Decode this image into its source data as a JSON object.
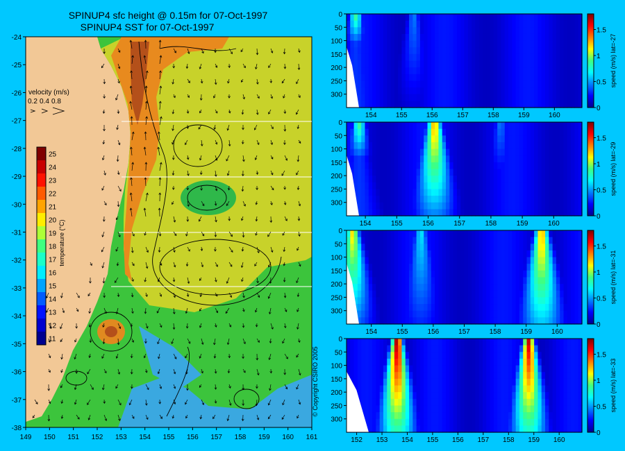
{
  "page": {
    "title_line1": "SPINUP4 sfc height @ 0.15m for 07-Oct-1997",
    "title_line2": "SPINUP4 SST for 07-Oct-1997",
    "copyright": "© Copyright CSIRO 2005"
  },
  "map": {
    "velocity_label": "velocity (m/s)",
    "velocity_scale": [
      "0.2",
      "0.4",
      "0.8"
    ],
    "colorbar_label": "temperature (°C)",
    "colorbar_ticks": [
      "25",
      "24",
      "23",
      "22",
      "21",
      "20",
      "19",
      "18",
      "17",
      "16",
      "15",
      "14",
      "13",
      "12",
      "11"
    ],
    "lon_ticks": [
      "149",
      "150",
      "151",
      "152",
      "153",
      "154",
      "155",
      "156",
      "157",
      "158",
      "159",
      "160",
      "161"
    ],
    "lat_ticks": [
      "-24",
      "-25",
      "-26",
      "-27",
      "-28",
      "-29",
      "-30",
      "-31",
      "-32",
      "-33",
      "-34",
      "-35",
      "-36",
      "-37",
      "-38"
    ],
    "section_lats": [
      "-27",
      "-29",
      "-31",
      "-33"
    ]
  },
  "chart_data": [
    {
      "type": "heatmap",
      "title": "",
      "ylabel": "speed (m/s) lat=-27",
      "xlim": [
        153.2,
        160.9
      ],
      "ylim": [
        350,
        0
      ],
      "x_ticks": [
        "154",
        "155",
        "156",
        "157",
        "158",
        "159",
        "160"
      ],
      "y_ticks": [
        "0",
        "50",
        "100",
        "150",
        "200",
        "250",
        "300"
      ],
      "colorbar_ticks": [
        "1.5",
        "1",
        "0.5",
        "0"
      ],
      "jets": [
        {
          "lon": 153.5,
          "peak_speed": 0.9,
          "depth": 100
        },
        {
          "lon": 155.4,
          "peak_speed": 0.45,
          "depth": 300
        }
      ]
    },
    {
      "type": "heatmap",
      "title": "",
      "ylabel": "speed (m/s) lat=-29",
      "xlim": [
        153.4,
        160.9
      ],
      "ylim": [
        350,
        0
      ],
      "x_ticks": [
        "154",
        "155",
        "156",
        "157",
        "158",
        "159",
        "160"
      ],
      "y_ticks": [
        "0",
        "50",
        "100",
        "150",
        "200",
        "250",
        "300"
      ],
      "colorbar_ticks": [
        "1.5",
        "1",
        "0.5",
        "0"
      ],
      "jets": [
        {
          "lon": 153.8,
          "peak_speed": 0.9,
          "depth": 120
        },
        {
          "lon": 156.2,
          "peak_speed": 1.3,
          "depth": 300
        },
        {
          "lon": 158.3,
          "peak_speed": 0.45,
          "depth": 200
        }
      ]
    },
    {
      "type": "heatmap",
      "title": "",
      "ylabel": "speed (m/s) lat=-31",
      "xlim": [
        153.2,
        160.8
      ],
      "ylim": [
        350,
        0
      ],
      "x_ticks": [
        "154",
        "155",
        "156",
        "157",
        "158",
        "159",
        "160"
      ],
      "y_ticks": [
        "0",
        "50",
        "100",
        "150",
        "200",
        "250",
        "300"
      ],
      "colorbar_ticks": [
        "1.5",
        "1",
        "0.5",
        "0"
      ],
      "jets": [
        {
          "lon": 153.4,
          "peak_speed": 1.2,
          "depth": 300
        },
        {
          "lon": 155.6,
          "peak_speed": 0.65,
          "depth": 350
        },
        {
          "lon": 159.5,
          "peak_speed": 1.3,
          "depth": 350
        }
      ]
    },
    {
      "type": "heatmap",
      "title": "",
      "ylabel": "speed (m/s) lat=-33",
      "xlim": [
        151.6,
        160.9
      ],
      "ylim": [
        350,
        0
      ],
      "x_ticks": [
        "152",
        "153",
        "154",
        "155",
        "156",
        "157",
        "158",
        "159",
        "160"
      ],
      "y_ticks": [
        "0",
        "50",
        "100",
        "150",
        "200",
        "250",
        "300"
      ],
      "colorbar_ticks": [
        "1.5",
        "1",
        "0.5",
        "0"
      ],
      "jets": [
        {
          "lon": 153.6,
          "peak_speed": 1.8,
          "depth": 350
        },
        {
          "lon": 158.8,
          "peak_speed": 1.7,
          "depth": 350
        }
      ]
    }
  ]
}
